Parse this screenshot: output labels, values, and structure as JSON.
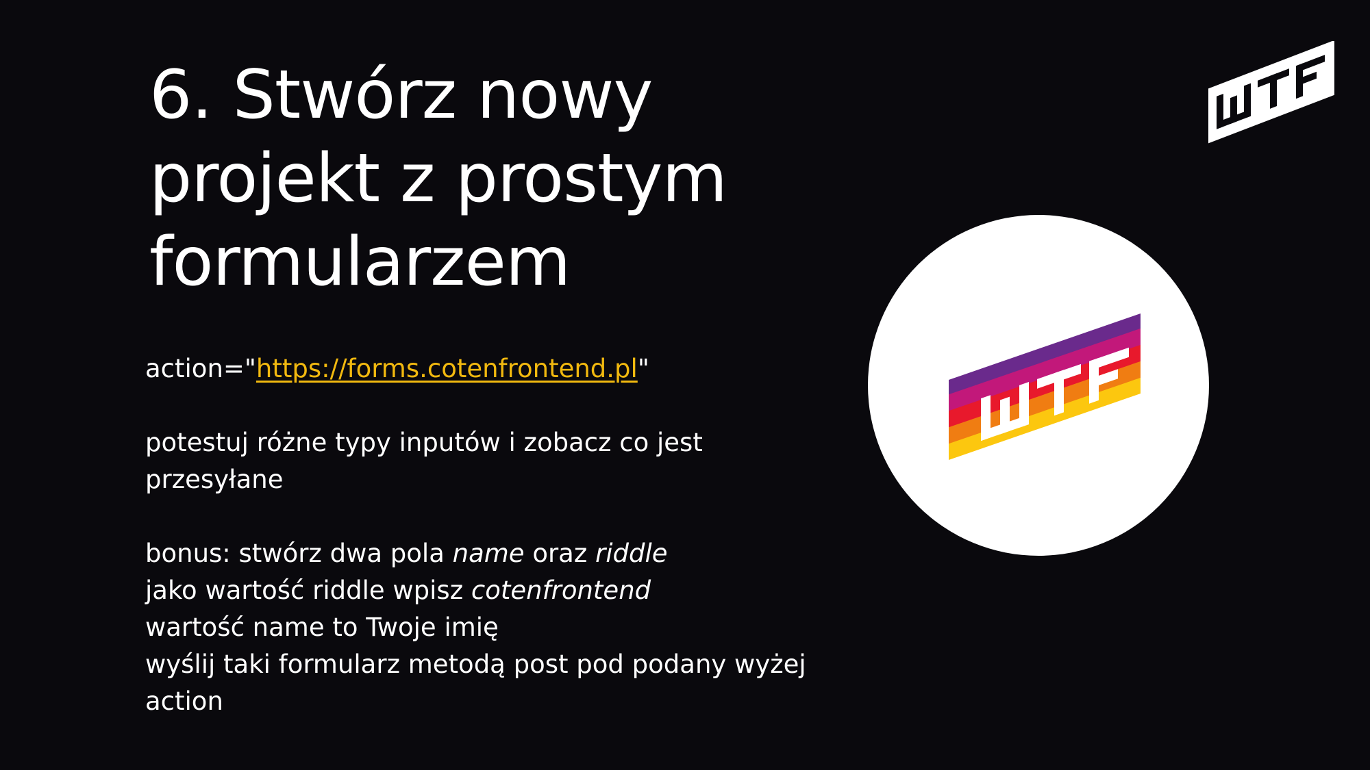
{
  "slide": {
    "title_lines": [
      "6. Stwórz nowy",
      "projekt z prostym",
      "formularzem"
    ],
    "action_prefix": "action=\"",
    "action_url": "https://forms.cotenfrontend.pl",
    "action_suffix": "\"",
    "test_lines": [
      "potestuj różne typy inputów i zobacz co jest",
      "przesyłane"
    ],
    "bonus": {
      "line1_a": "bonus: stwórz dwa pola ",
      "line1_name": "name",
      "line1_b": " oraz ",
      "line1_riddle": "riddle",
      "line2_a": "jako wartość riddle wpisz ",
      "line2_value": "cotenfrontend",
      "line3": "wartość name to Twoje imię",
      "line4": "wyślij taki formularz metodą post pod podany wyżej",
      "line5": "action"
    }
  },
  "logos": {
    "corner_logo": "WTF",
    "center_logo": "WTF"
  },
  "colors": {
    "background": "#0a090d",
    "text": "#ffffff",
    "link": "#f2b90f",
    "stripe_purple": "#6a2a8c",
    "stripe_magenta": "#c2187a",
    "stripe_red": "#e8192c",
    "stripe_orange": "#f07d12",
    "stripe_yellow": "#fcc70f"
  },
  "icons": {
    "corner": "wtf-logo-icon",
    "center": "wtf-rainbow-logo-icon"
  }
}
